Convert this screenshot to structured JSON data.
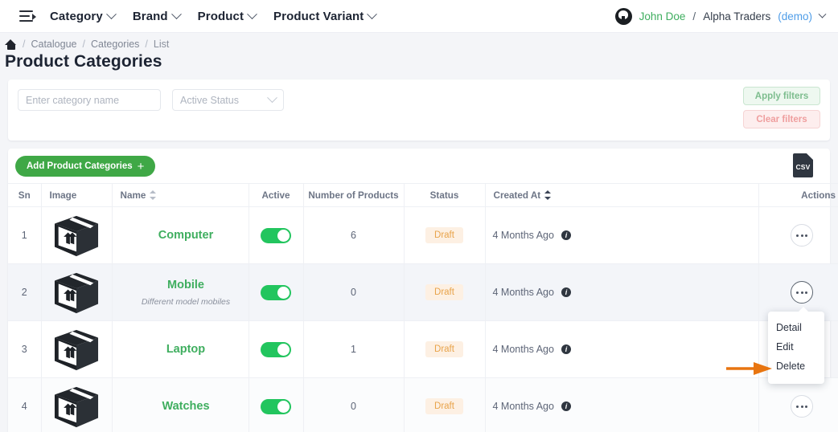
{
  "navbar": {
    "menu_icon": "hamburger-collapse-icon",
    "items": [
      {
        "label": "Category"
      },
      {
        "label": "Brand"
      },
      {
        "label": "Product"
      },
      {
        "label": "Product Variant"
      }
    ],
    "user": {
      "avatar_icon": "github-icon",
      "name": "John Doe",
      "separator": "/",
      "org": "Alpha Traders",
      "mode": "(demo)"
    }
  },
  "breadcrumb": {
    "home_icon": "home-icon",
    "items": [
      "Catalogue",
      "Categories",
      "List"
    ],
    "separator": "/"
  },
  "page": {
    "title": "Product Categories"
  },
  "filters": {
    "name_placeholder": "Enter category name",
    "name_value": "",
    "status_placeholder": "Active Status",
    "apply_label": "Apply filters",
    "clear_label": "Clear filters"
  },
  "toolbar": {
    "add_label": "Add Product Categories",
    "add_plus": "+",
    "export_icon": "csv-file-icon",
    "export_label": "CSV"
  },
  "table": {
    "headers": {
      "sn": "Sn",
      "image": "Image",
      "name": "Name",
      "active": "Active",
      "number_of_products": "Number of Products",
      "status": "Status",
      "created_at": "Created At",
      "actions": "Actions"
    },
    "rows": [
      {
        "sn": "1",
        "image_icon": "package-box-icon",
        "name": "Computer",
        "description": "",
        "active": true,
        "number_of_products": "6",
        "status": "Draft",
        "created_at": "4 Months Ago",
        "info_icon": "info-icon",
        "actions_icon": "ellipsis-icon"
      },
      {
        "sn": "2",
        "image_icon": "package-box-icon",
        "name": "Mobile",
        "description": "Different model mobiles",
        "active": true,
        "number_of_products": "0",
        "status": "Draft",
        "created_at": "4 Months Ago",
        "info_icon": "info-icon",
        "actions_icon": "ellipsis-icon"
      },
      {
        "sn": "3",
        "image_icon": "package-box-icon",
        "name": "Laptop",
        "description": "",
        "active": true,
        "number_of_products": "1",
        "status": "Draft",
        "created_at": "4 Months Ago",
        "info_icon": "info-icon",
        "actions_icon": "ellipsis-icon"
      },
      {
        "sn": "4",
        "image_icon": "package-box-icon",
        "name": "Watches",
        "description": "",
        "active": true,
        "number_of_products": "0",
        "status": "Draft",
        "created_at": "4 Months Ago",
        "info_icon": "info-icon",
        "actions_icon": "ellipsis-icon"
      }
    ]
  },
  "action_menu": {
    "items": [
      "Detail",
      "Edit",
      "Delete"
    ],
    "highlighted": "Delete"
  },
  "annotation": {
    "arrow_icon": "arrow-right-pointer",
    "color": "#e87510"
  },
  "colors": {
    "brand_green": "#3fa846",
    "name_green": "#3fae5f",
    "toggle_green": "#22c55e",
    "badge_bg": "#fdf0e3",
    "badge_text": "#e8a34a",
    "apply_border": "#cae6d1",
    "clear_border": "#f6d4d4",
    "arrow_orange": "#e87510",
    "row_highlight": "#f3f5f9"
  }
}
